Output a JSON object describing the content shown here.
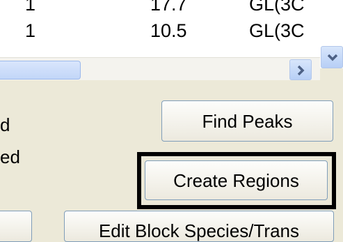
{
  "list": {
    "rows": [
      {
        "col1": "1",
        "col2": "17.7",
        "col3": "GL(3C"
      },
      {
        "col1": "1",
        "col2": "10.5",
        "col3": "GL(3C"
      }
    ]
  },
  "scrollbar": {
    "down_icon": "chevron-down-icon",
    "right_icon": "chevron-right-icon",
    "accent": "#4d6185"
  },
  "labels": {
    "label1": "d",
    "label2": "ed"
  },
  "buttons": {
    "find_peaks": "Find Peaks",
    "create_regions": "Create Regions",
    "edit_block": "Edit Block Species/Trans"
  }
}
